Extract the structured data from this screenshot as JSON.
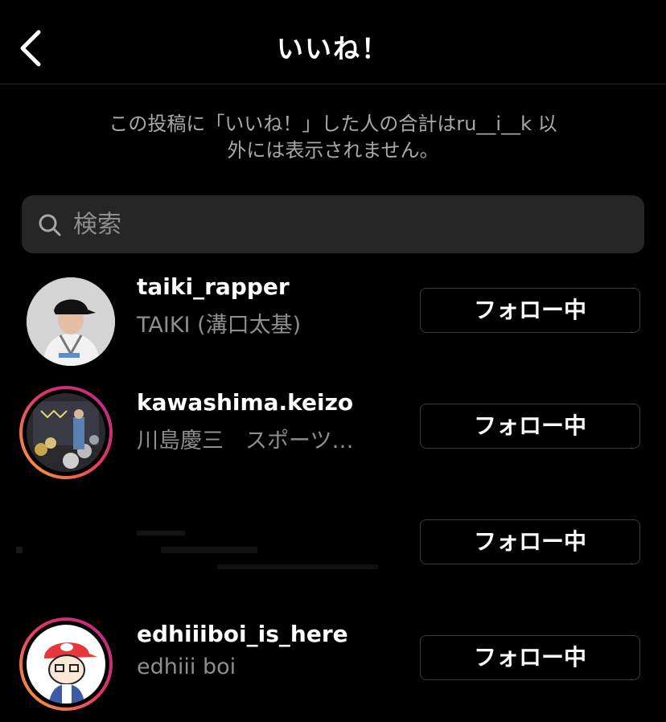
{
  "header": {
    "title": "いいね！",
    "back_icon": "chevron-left-icon"
  },
  "notice": {
    "line1": "この投稿に「いいね！」した人の合計はru__i__k 以",
    "line2": "外には表示されません。"
  },
  "search": {
    "icon": "search-icon",
    "placeholder": "検索"
  },
  "users": [
    {
      "username": "taiki_rapper",
      "fullname": "TAIKI (溝口太基)",
      "button": "フォロー中"
    },
    {
      "username": "kawashima.keizo",
      "fullname": "川島慶三　スポーツ…",
      "button": "フォロー中"
    },
    {
      "username": "",
      "fullname": "",
      "button": "フォロー中"
    },
    {
      "username": "edhiiiboi_is_here",
      "fullname": "edhiii boi",
      "button": "フォロー中"
    }
  ],
  "colors": {
    "background": "#000000",
    "secondary_text": "#8e8e8e",
    "search_bg": "#262626",
    "button_border": "#3b3b3b",
    "story_ring_start": "#f9a539",
    "story_ring_end": "#b42b8d"
  }
}
